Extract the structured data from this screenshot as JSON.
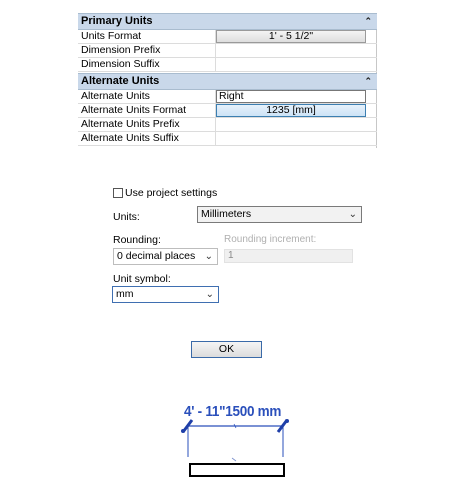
{
  "properties": {
    "groups": [
      {
        "title": "Primary Units",
        "rows": [
          {
            "name": "Units Format",
            "value": "1' - 5 1/2\""
          },
          {
            "name": "Dimension Prefix",
            "value": ""
          },
          {
            "name": "Dimension Suffix",
            "value": ""
          }
        ]
      },
      {
        "title": "Alternate Units",
        "rows": [
          {
            "name": "Alternate Units",
            "value": "Right"
          },
          {
            "name": "Alternate Units Format",
            "value": "1235 [mm]"
          },
          {
            "name": "Alternate Units Prefix",
            "value": ""
          },
          {
            "name": "Alternate Units Suffix",
            "value": ""
          }
        ]
      }
    ],
    "collapse_glyph": "⌃"
  },
  "dialog": {
    "use_project_settings_label": "Use project settings",
    "use_project_settings_checked": false,
    "units_label": "Units:",
    "units_value": "Millimeters",
    "rounding_label": "Rounding:",
    "rounding_value": "0 decimal places",
    "rounding_increment_label": "Rounding increment:",
    "rounding_increment_value": "1",
    "unit_symbol_label": "Unit symbol:",
    "unit_symbol_value": "mm",
    "ok_label": "OK"
  },
  "dimension": {
    "text": "4' - 11\"1500 mm",
    "color": "#2a4fbb"
  }
}
